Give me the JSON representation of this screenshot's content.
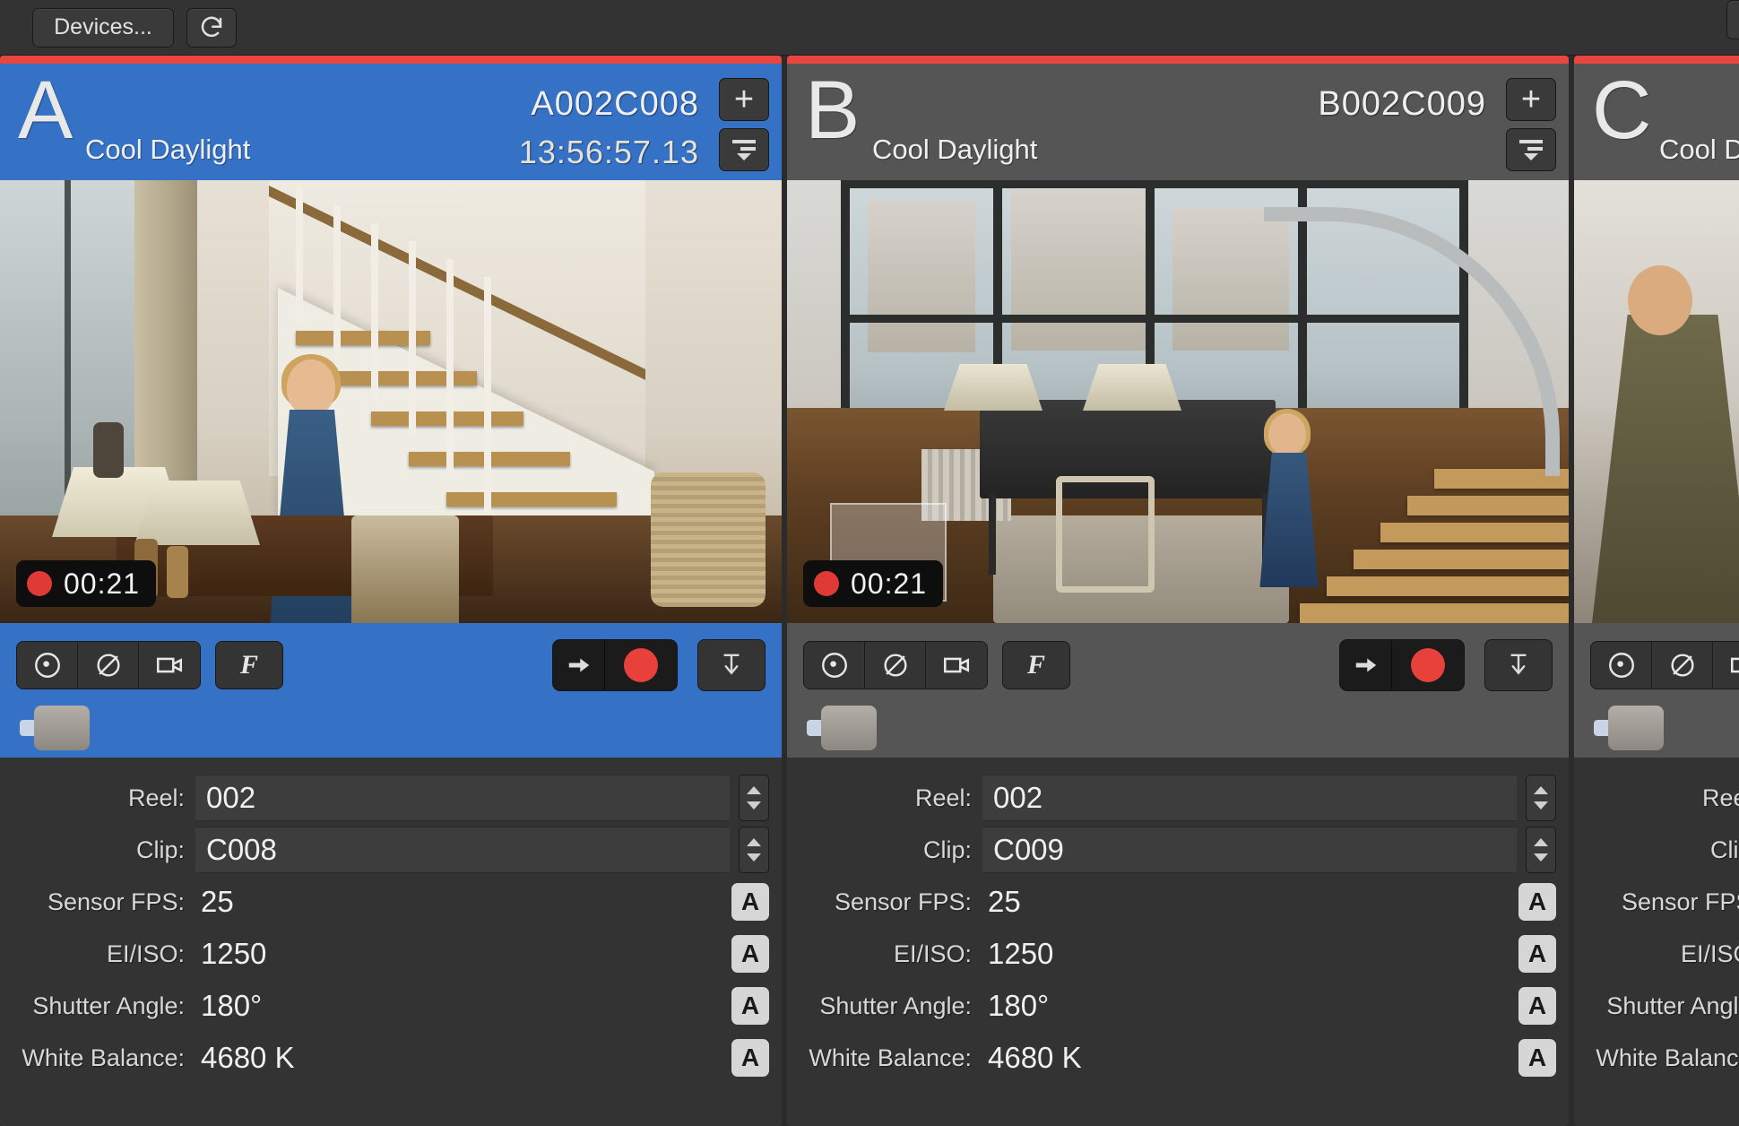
{
  "toolbar": {
    "devices_label": "Devices...",
    "refresh_icon": "refresh-icon"
  },
  "colors": {
    "selected_panel": "#3572c6",
    "record_red": "#e8463f",
    "panel_header": "#555555",
    "app_background": "#2b2b2b"
  },
  "labels": {
    "reel": "Reel:",
    "clip": "Clip:",
    "sensor_fps": "Sensor FPS:",
    "ei_iso": "EI/ISO:",
    "shutter_angle": "Shutter Angle:",
    "white_balance": "White Balance:",
    "auto_badge": "A",
    "plus": "+",
    "f_button": "F"
  },
  "panels": [
    {
      "letter": "A",
      "preset": "Cool Daylight",
      "clip_id": "A002C008",
      "timecode": "13:56:57.13",
      "selected": true,
      "recording": true,
      "rec_time": "00:21",
      "reel": "002",
      "clip": "C008",
      "sensor_fps": "25",
      "ei_iso": "1250",
      "shutter_angle": "180°",
      "white_balance": "4680 K"
    },
    {
      "letter": "B",
      "preset": "Cool Daylight",
      "clip_id": "B002C009",
      "timecode": "",
      "selected": false,
      "recording": true,
      "rec_time": "00:21",
      "reel": "002",
      "clip": "C009",
      "sensor_fps": "25",
      "ei_iso": "1250",
      "shutter_angle": "180°",
      "white_balance": "4680 K"
    },
    {
      "letter": "C",
      "preset": "Cool D",
      "clip_id": "",
      "timecode": "",
      "selected": false,
      "recording": false,
      "rec_time": "",
      "reel": "",
      "clip": "",
      "sensor_fps": "",
      "ei_iso": "",
      "shutter_angle": "",
      "white_balance": ""
    }
  ],
  "control_icons": [
    "iris-icon",
    "nd-filter-icon",
    "camera-icon",
    "focus-f-icon",
    "arrow-right-icon",
    "record-icon",
    "download-icon"
  ]
}
